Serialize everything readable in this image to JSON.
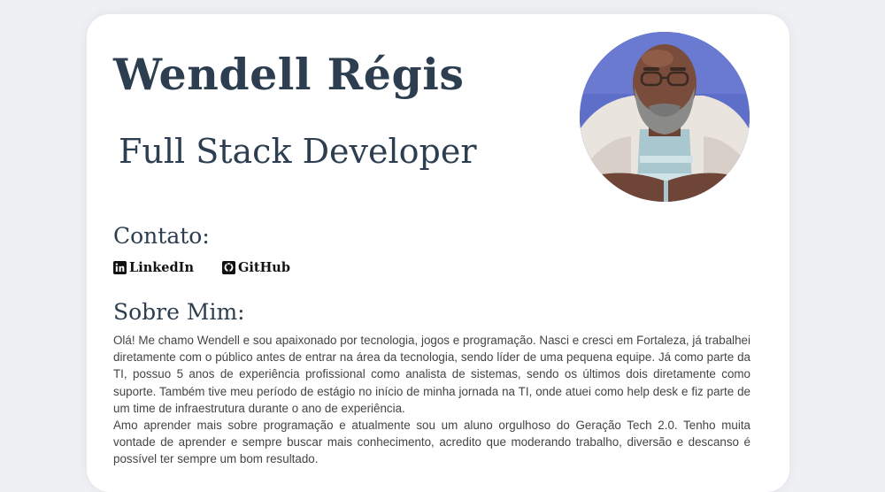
{
  "profile": {
    "name": "Wendell Régis",
    "role": "Full Stack Developer",
    "avatar_icon": "person-avatar-illustration"
  },
  "contact": {
    "title": "Contato:",
    "links": [
      {
        "label": "LinkedIn",
        "icon": "linkedin-icon"
      },
      {
        "label": "GitHub",
        "icon": "github-icon"
      }
    ]
  },
  "about": {
    "title": "Sobre Mim:",
    "paragraphs": [
      "Olá! Me chamo Wendell e sou apaixonado por tecnologia, jogos e programação. Nasci e cresci em Fortaleza, já trabalhei diretamente com o público antes de entrar na área da tecnologia, sendo líder de uma pequena equipe. Já como parte da TI, possuo 5 anos de experiência profissional como analista de sistemas, sendo os últimos dois diretamente como suporte. Também tive meu período de estágio no início de minha jornada na TI, onde atuei como help desk e fiz parte de um time de infraestrutura durante o ano de experiência.",
      "Amo aprender mais sobre programação e atualmente sou um aluno orgulhoso do Geração Tech 2.0. Tenho muita vontade de aprender e sempre buscar mais conhecimento, acredito que moderando trabalho, diversão e descanso é possível ter sempre um bom resultado."
    ]
  },
  "colors": {
    "background": "#eff0f4",
    "card": "#ffffff",
    "heading": "#2c3e50",
    "body_text": "#444444",
    "avatar_bg": "#5d6fc9"
  }
}
